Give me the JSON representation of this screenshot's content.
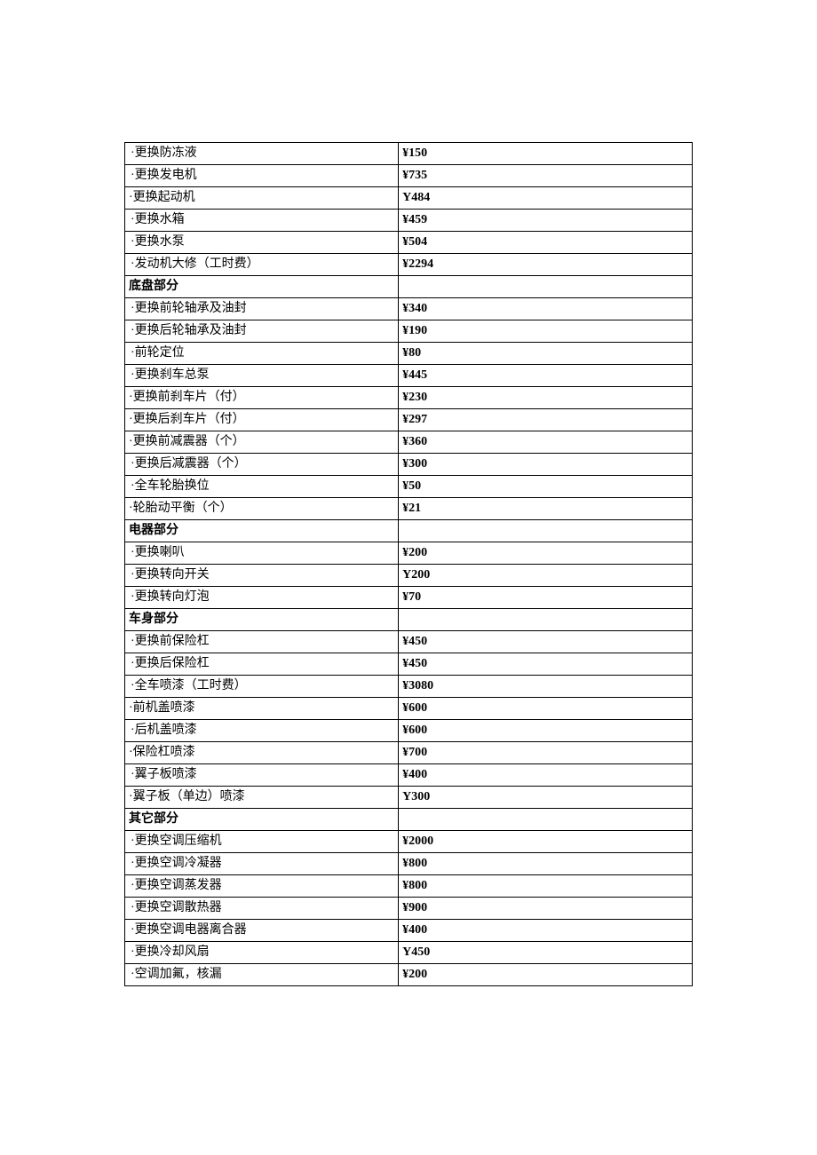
{
  "rows": [
    {
      "type": "item",
      "label": "·更换防冻液",
      "price": "¥150",
      "indent": true
    },
    {
      "type": "item",
      "label": "·更换发电机",
      "price": "¥735",
      "indent": true
    },
    {
      "type": "item",
      "label": "·更换起动机",
      "price": "Y484",
      "indent": false
    },
    {
      "type": "item",
      "label": "·更换水箱",
      "price": "¥459",
      "indent": true
    },
    {
      "type": "item",
      "label": "·更换水泵",
      "price": "¥504",
      "indent": true
    },
    {
      "type": "item",
      "label": "·发动机大修（工时费）",
      "price": "¥2294",
      "indent": true
    },
    {
      "type": "section",
      "label": "底盘部分",
      "price": ""
    },
    {
      "type": "item",
      "label": "·更换前轮轴承及油封",
      "price": "¥340",
      "indent": true
    },
    {
      "type": "item",
      "label": "·更换后轮轴承及油封",
      "price": "¥190",
      "indent": true
    },
    {
      "type": "item",
      "label": "·前轮定位",
      "price": "¥80",
      "indent": true
    },
    {
      "type": "item",
      "label": "·更换刹车总泵",
      "price": "¥445",
      "indent": true
    },
    {
      "type": "item",
      "label": "·更换前刹车片（付）",
      "price": "¥230",
      "indent": false
    },
    {
      "type": "item",
      "label": "·更换后刹车片（付）",
      "price": "¥297",
      "indent": false
    },
    {
      "type": "item",
      "label": "·更换前减震器（个）",
      "price": "¥360",
      "indent": false
    },
    {
      "type": "item",
      "label": "·更换后减震器（个）",
      "price": "¥300",
      "indent": true
    },
    {
      "type": "item",
      "label": "·全车轮胎换位",
      "price": "¥50",
      "indent": true
    },
    {
      "type": "item",
      "label": "·轮胎动平衡（个）",
      "price": "¥21",
      "indent": false
    },
    {
      "type": "section",
      "label": "电器部分",
      "price": ""
    },
    {
      "type": "item",
      "label": "·更换喇叭",
      "price": "¥200",
      "indent": true
    },
    {
      "type": "item",
      "label": "·更换转向开关",
      "price": "Y200",
      "indent": true
    },
    {
      "type": "item",
      "label": "·更换转向灯泡",
      "price": "¥70",
      "indent": true
    },
    {
      "type": "section",
      "label": "车身部分",
      "price": ""
    },
    {
      "type": "item",
      "label": "·更换前保险杠",
      "price": "¥450",
      "indent": true
    },
    {
      "type": "item",
      "label": "·更换后保险杠",
      "price": "¥450",
      "indent": true
    },
    {
      "type": "item",
      "label": "·全车喷漆（工时费）",
      "price": "¥3080",
      "indent": true
    },
    {
      "type": "item",
      "label": "·前机盖喷漆",
      "price": "¥600",
      "indent": false
    },
    {
      "type": "item",
      "label": "·后机盖喷漆",
      "price": "¥600",
      "indent": true
    },
    {
      "type": "item",
      "label": "·保险杠喷漆",
      "price": "¥700",
      "indent": false
    },
    {
      "type": "item",
      "label": "·翼子板喷漆",
      "price": "¥400",
      "indent": true
    },
    {
      "type": "item",
      "label": "·翼子板（单边）喷漆",
      "price": "Y300",
      "indent": false
    },
    {
      "type": "section",
      "label": "其它部分",
      "price": ""
    },
    {
      "type": "item",
      "label": "·更换空调压缩机",
      "price": "¥2000",
      "indent": true
    },
    {
      "type": "item",
      "label": "·更换空调冷凝器",
      "price": "¥800",
      "indent": true
    },
    {
      "type": "item",
      "label": "·更换空调蒸发器",
      "price": "¥800",
      "indent": true
    },
    {
      "type": "item",
      "label": "·更换空调散热器",
      "price": "¥900",
      "indent": true
    },
    {
      "type": "item",
      "label": "·更换空调电器离合器",
      "price": "¥400",
      "indent": true
    },
    {
      "type": "item",
      "label": "·更换冷却风扇",
      "price": "Y450",
      "indent": true
    },
    {
      "type": "item",
      "label": "·空调加氟，核漏",
      "price": "¥200",
      "indent": true
    }
  ]
}
